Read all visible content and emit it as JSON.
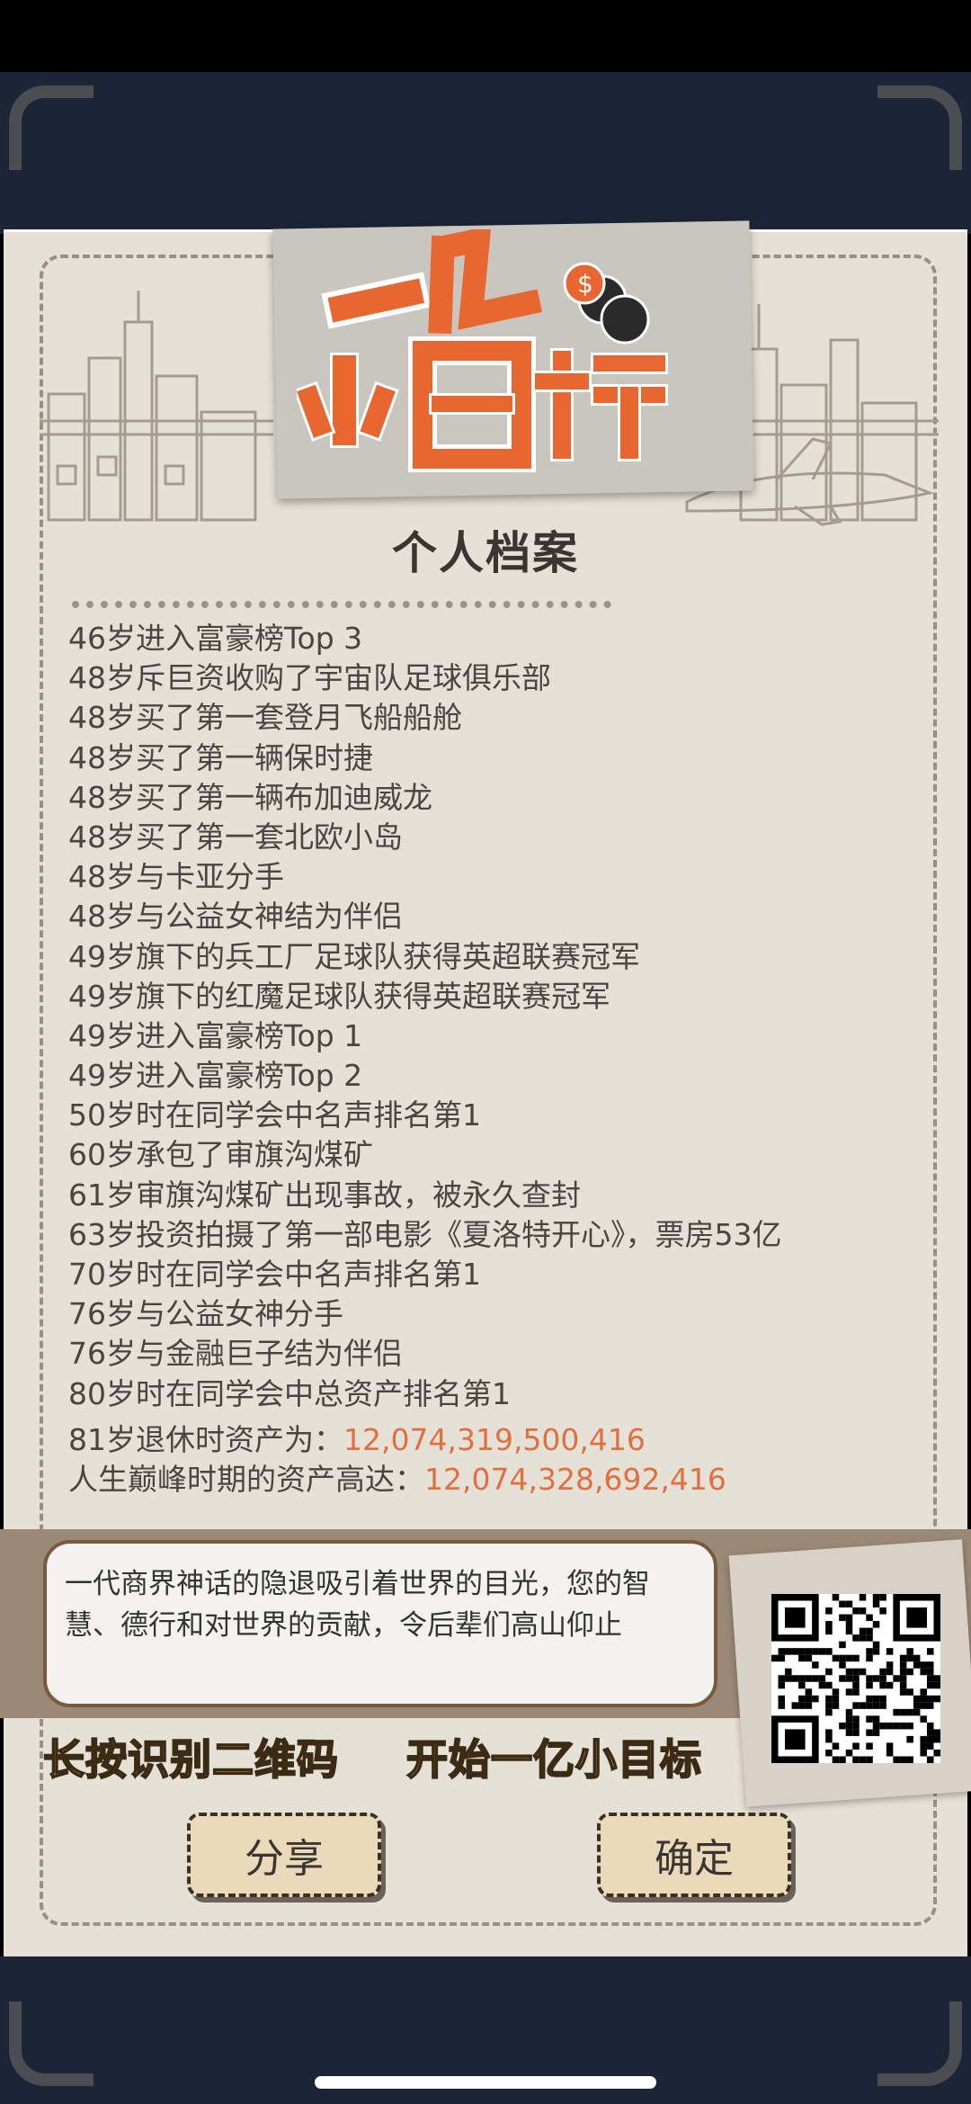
{
  "logo": {
    "line1": "一亿",
    "line2": "小目标"
  },
  "page_title": "个人档案",
  "events": [
    "46岁进入富豪榜Top 3",
    "48岁斥巨资收购了宇宙队足球俱乐部",
    "48岁买了第一套登月飞船船舱",
    "48岁买了第一辆保时捷",
    "48岁买了第一辆布加迪威龙",
    "48岁买了第一套北欧小岛",
    "48岁与卡亚分手",
    "48岁与公益女神结为伴侣",
    "49岁旗下的兵工厂足球队获得英超联赛冠军",
    "49岁旗下的红魔足球队获得英超联赛冠军",
    "49岁进入富豪榜Top 1",
    "49岁进入富豪榜Top 2",
    "50岁时在同学会中名声排名第1",
    "60岁承包了审旗沟煤矿",
    "61岁审旗沟煤矿出现事故，被永久查封",
    "63岁投资拍摄了第一部电影《夏洛特开心》，票房53亿",
    "70岁时在同学会中名声排名第1",
    "76岁与公益女神分手",
    "76岁与金融巨子结为伴侣",
    "80岁时在同学会中总资产排名第1"
  ],
  "retire": {
    "label": "81岁退休时资产为：",
    "value": "12,074,319,500,416"
  },
  "peak": {
    "label": "人生巅峰时期的资产高达：",
    "value": "12,074,328,692,416"
  },
  "message": "一代商界神话的隐退吸引着世界的目光，您的智慧、德行和对世界的贡献，令后辈们高山仰止",
  "captions": {
    "left": "长按识别二维码",
    "right": "开始一亿小目标"
  },
  "buttons": {
    "share": "分享",
    "confirm": "确定"
  },
  "colors": {
    "accent_orange": "#e07040",
    "caption_yellow": "#f0c660",
    "frame_navy": "#1b2535",
    "paper": "#e5e1d6"
  }
}
